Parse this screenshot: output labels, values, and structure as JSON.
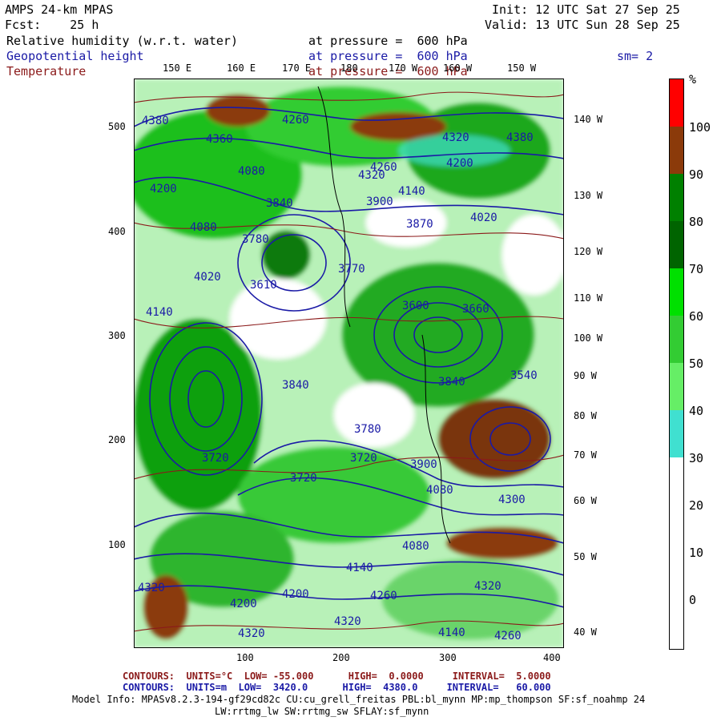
{
  "header": {
    "model": "AMPS 24-km MPAS",
    "init": "Init: 12 UTC Sat 27 Sep 25",
    "fcst": "Fcst:    25 h",
    "valid": "Valid: 13 UTC Sun 28 Sep 25"
  },
  "fields": [
    {
      "name": "Relative humidity (w.r.t. water)",
      "pressure": "at pressure =  600 hPa",
      "color": "#000000"
    },
    {
      "name": "Geopotential height",
      "pressure": "at pressure =  600 hPa",
      "color": "#1a1aa6"
    },
    {
      "name": "Temperature",
      "pressure": "at pressure =  600 hPa",
      "color": "#8b1a1a"
    }
  ],
  "smoothing": "sm= 2",
  "top_lon_labels": [
    "150 E",
    "160 E",
    "170 E",
    "180",
    "170 W",
    "160 W",
    "150 W"
  ],
  "right_lon_labels": [
    "140 W",
    "130 W",
    "120 W",
    "110 W",
    "100 W",
    "90 W",
    "80 W",
    "70 W",
    "60 W",
    "50 W",
    "40 W"
  ],
  "y_ticks": [
    "500",
    "400",
    "300",
    "200",
    "100"
  ],
  "x_ticks": [
    "100",
    "200",
    "300",
    "400"
  ],
  "height_labels": [
    "4380",
    "4360",
    "4260",
    "4080",
    "4200",
    "4080",
    "4320",
    "4200",
    "3840",
    "3780",
    "4020",
    "3610",
    "4140",
    "4260",
    "4320",
    "4140",
    "4020",
    "3900",
    "3870",
    "3770",
    "3600",
    "3660",
    "3540",
    "3840",
    "3840",
    "3780",
    "3720",
    "3720",
    "3720",
    "4080",
    "4300",
    "3900",
    "4200",
    "4320",
    "4080",
    "4140",
    "4200",
    "4260",
    "4320",
    "4320",
    "4140",
    "4260",
    "4320",
    "4380"
  ],
  "colorbar": {
    "unit": "%",
    "labels": [
      "100",
      "90",
      "80",
      "70",
      "60",
      "50",
      "40",
      "30",
      "20",
      "10",
      "0"
    ],
    "colors": [
      "#ff0000",
      "#8b3a0a",
      "#008000",
      "#006400",
      "#00cc00",
      "#33dd33",
      "#66ee66",
      "#40e0d0",
      "#ffffff",
      "#ffffff",
      "#ffffff",
      "#ffffff"
    ]
  },
  "footer": {
    "temp_contours": "CONTOURS:  UNITS=°C  LOW= -55.000      HIGH=  0.0000     INTERVAL=  5.0000",
    "height_contours": "CONTOURS:  UNITS=m  LOW=  3420.0      HIGH=  4380.0     INTERVAL=   60.000",
    "model_info_1": "Model Info: MPASv8.2.3-194-gf29cd82c CU:cu_grell_freitas PBL:bl_mynn MP:mp_thompson SF:sf_noahmp 24",
    "model_info_2": "LW:rrtmg_lw SW:rrtmg_sw SFLAY:sf_mynn"
  },
  "legend_colors": {
    "rh_high": "#8b3a0a",
    "rh_mid": "#008000",
    "rh_low": "#40e0d0",
    "height": "#1a1aa6",
    "temperature": "#8b1a1a"
  }
}
